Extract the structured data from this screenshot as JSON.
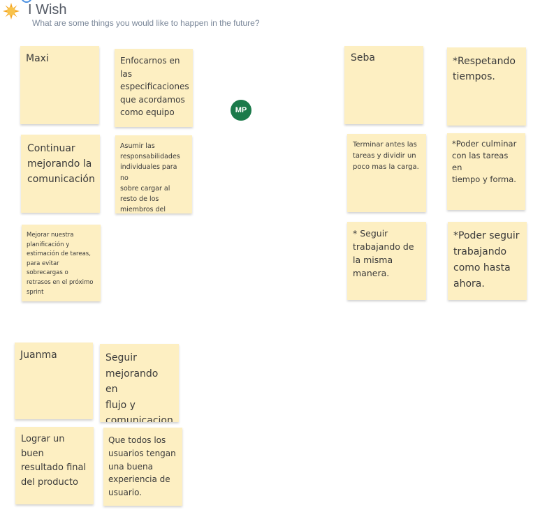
{
  "header": {
    "icon": "sun-icon",
    "title": "I Wish",
    "subtitle": "What are some things you would like to happen in the future?"
  },
  "avatar": {
    "initials": "MP",
    "color": "#1b7a4a"
  },
  "colors": {
    "sticky_note": "#fdefc2",
    "title_text": "#555b66",
    "subtitle_text": "#7a8799"
  },
  "notes": {
    "maxi": "Maxi",
    "enfocarnos": "Enfocarnos en\nlas\nespecificaciones\nque acordamos\ncomo equipo",
    "continuar": "Continuar\nmejorando la\ncomunicación",
    "asumir": "Asumir las\nresponsabilidades\nindividuales para no\nsobre cargar al\nresto de los\nmiembros del equipo",
    "mejorar": "Mejorar nuestra\nplanificación y\nestimación de tareas,\npara evitar\nsobrecargas o\nretrasos en el próximo\nsprint",
    "seba": "Seba",
    "respetando": "*Respetando\ntiempos.",
    "terminar": "Terminar antes las\ntareas y dividir un\npoco mas la carga.",
    "poder_culminar": "*Poder culminar\ncon las tareas en\ntiempo y forma.",
    "seguir_trabajando": "* Seguir\ntrabajando de\nla misma\nmanera.",
    "poder_seguir": "*Poder seguir\ntrabajando\ncomo hasta\nahora.",
    "juanma": "Juanma",
    "seguir_mejorando": "Seguir\nmejorando en\nflujo y\ncomunicacion",
    "lograr": "Lograr un buen\nresultado final\ndel producto",
    "que_todos": "Que todos los\nusuarios tengan\nuna buena\nexperiencia de\nusuario."
  }
}
